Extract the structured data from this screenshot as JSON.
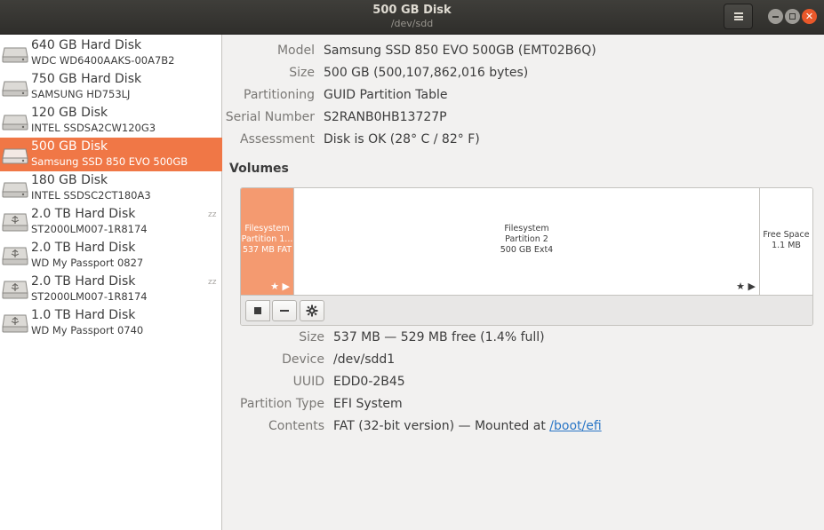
{
  "window": {
    "title": "500 GB Disk",
    "subtitle": "/dev/sdd"
  },
  "sidebar": {
    "drives": [
      {
        "name": "640 GB Hard Disk",
        "model": "WDC WD6400AAKS-00A7B2",
        "icon": "hard-disk-icon",
        "selected": false,
        "sleeping": false
      },
      {
        "name": "750 GB Hard Disk",
        "model": "SAMSUNG HD753LJ",
        "icon": "hard-disk-icon",
        "selected": false,
        "sleeping": false
      },
      {
        "name": "120 GB Disk",
        "model": "INTEL SSDSA2CW120G3",
        "icon": "hard-disk-icon",
        "selected": false,
        "sleeping": false
      },
      {
        "name": "500 GB Disk",
        "model": "Samsung SSD 850 EVO 500GB",
        "icon": "hard-disk-icon",
        "selected": true,
        "sleeping": false
      },
      {
        "name": "180 GB Disk",
        "model": "INTEL SSDSC2CT180A3",
        "icon": "hard-disk-icon",
        "selected": false,
        "sleeping": false
      },
      {
        "name": "2.0 TB Hard Disk",
        "model": "ST2000LM007-1R8174",
        "icon": "usb-disk-icon",
        "selected": false,
        "sleeping": true
      },
      {
        "name": "2.0 TB Hard Disk",
        "model": "WD My Passport 0827",
        "icon": "usb-disk-icon",
        "selected": false,
        "sleeping": false
      },
      {
        "name": "2.0 TB Hard Disk",
        "model": "ST2000LM007-1R8174",
        "icon": "usb-disk-icon",
        "selected": false,
        "sleeping": true
      },
      {
        "name": "1.0 TB Hard Disk",
        "model": "WD My Passport 0740",
        "icon": "usb-disk-icon",
        "selected": false,
        "sleeping": false
      }
    ],
    "sleep_glyph": "zz"
  },
  "disk": {
    "model_label": "Model",
    "model": "Samsung SSD 850 EVO 500GB (EMT02B6Q)",
    "size_label": "Size",
    "size": "500 GB (500,107,862,016 bytes)",
    "partitioning_label": "Partitioning",
    "partitioning": "GUID Partition Table",
    "serial_label": "Serial Number",
    "serial": "S2RANB0HB13727P",
    "assessment_label": "Assessment",
    "assessment": "Disk is OK (28° C / 82° F)"
  },
  "volumes": {
    "title": "Volumes",
    "segments": [
      {
        "line1": "Filesystem",
        "line2": "Partition 1...",
        "line3": "537 MB FAT",
        "selected": true
      },
      {
        "line1": "Filesystem",
        "line2": "Partition 2",
        "line3": "500 GB Ext4",
        "selected": false
      },
      {
        "line1": "Free Space",
        "line2": "1.1 MB",
        "selected": false
      }
    ],
    "toolbar": {
      "stop_icon": "stop-icon",
      "minus_icon": "minus-icon",
      "gear_icon": "gear-icon"
    }
  },
  "partition": {
    "size_label": "Size",
    "size": "537 MB — 529 MB free (1.4% full)",
    "device_label": "Device",
    "device": "/dev/sdd1",
    "uuid_label": "UUID",
    "uuid": "EDD0-2B45",
    "type_label": "Partition Type",
    "type": "EFI System",
    "contents_label": "Contents",
    "contents_prefix": "FAT (32-bit version) — Mounted at ",
    "contents_link": "/boot/efi"
  },
  "colors": {
    "accent": "#f07746",
    "selected_segment": "#f49a70",
    "link": "#2a76c6",
    "headerbar": "#3a3936"
  }
}
